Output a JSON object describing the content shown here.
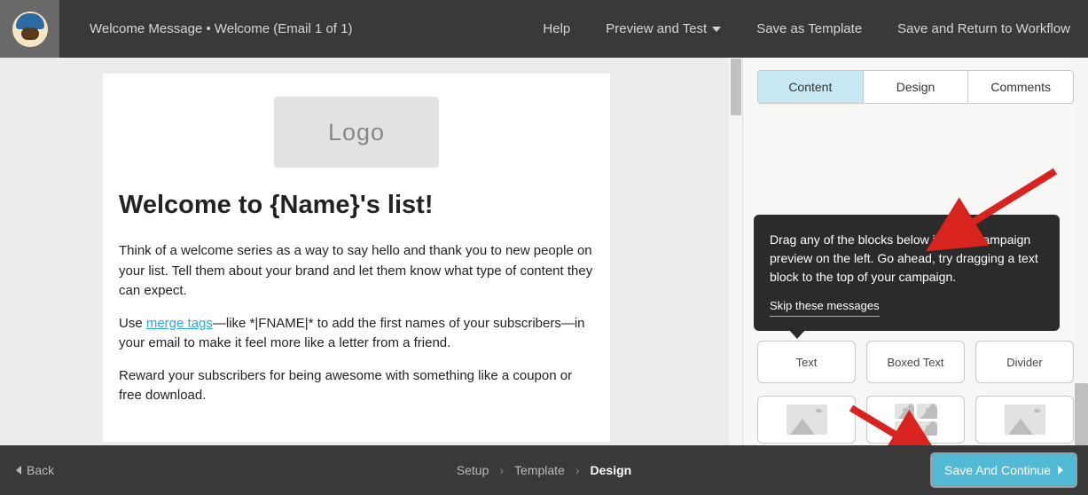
{
  "header": {
    "title": "Welcome Message • Welcome (Email 1 of 1)",
    "nav": {
      "help": "Help",
      "preview": "Preview and Test",
      "save_template": "Save as Template",
      "save_return": "Save and Return to Workflow"
    }
  },
  "canvas": {
    "logo_placeholder": "Logo",
    "heading": "Welcome to {Name}'s list!",
    "p1": "Think of a welcome series as a way to say hello and thank you to new people on your list. Tell them about your brand and let them know what type of content they can expect.",
    "p2_pre": "Use ",
    "p2_link": "merge tags",
    "p2_post": "—like *|FNAME|* to add the first names of your subscribers—in your email to make it feel more like a letter from a friend.",
    "p3": "Reward your subscribers for being awesome with something like a coupon or free download."
  },
  "side": {
    "tabs": {
      "content": "Content",
      "design": "Design",
      "comments": "Comments"
    },
    "blocks": {
      "text": "Text",
      "boxed": "Boxed Text",
      "divider": "Divider"
    },
    "tooltip": {
      "body": "Drag any of the blocks below into the campaign preview on the left. Go ahead, try dragging a text block to the top of your campaign.",
      "skip": "Skip these messages"
    }
  },
  "bottom": {
    "back": "Back",
    "steps": {
      "setup": "Setup",
      "template": "Template",
      "design": "Design"
    },
    "save_continue": "Save And Continue"
  },
  "colors": {
    "accent": "#52BAD5",
    "tab_active": "#c5e8f3",
    "arrow": "#d8231f"
  }
}
